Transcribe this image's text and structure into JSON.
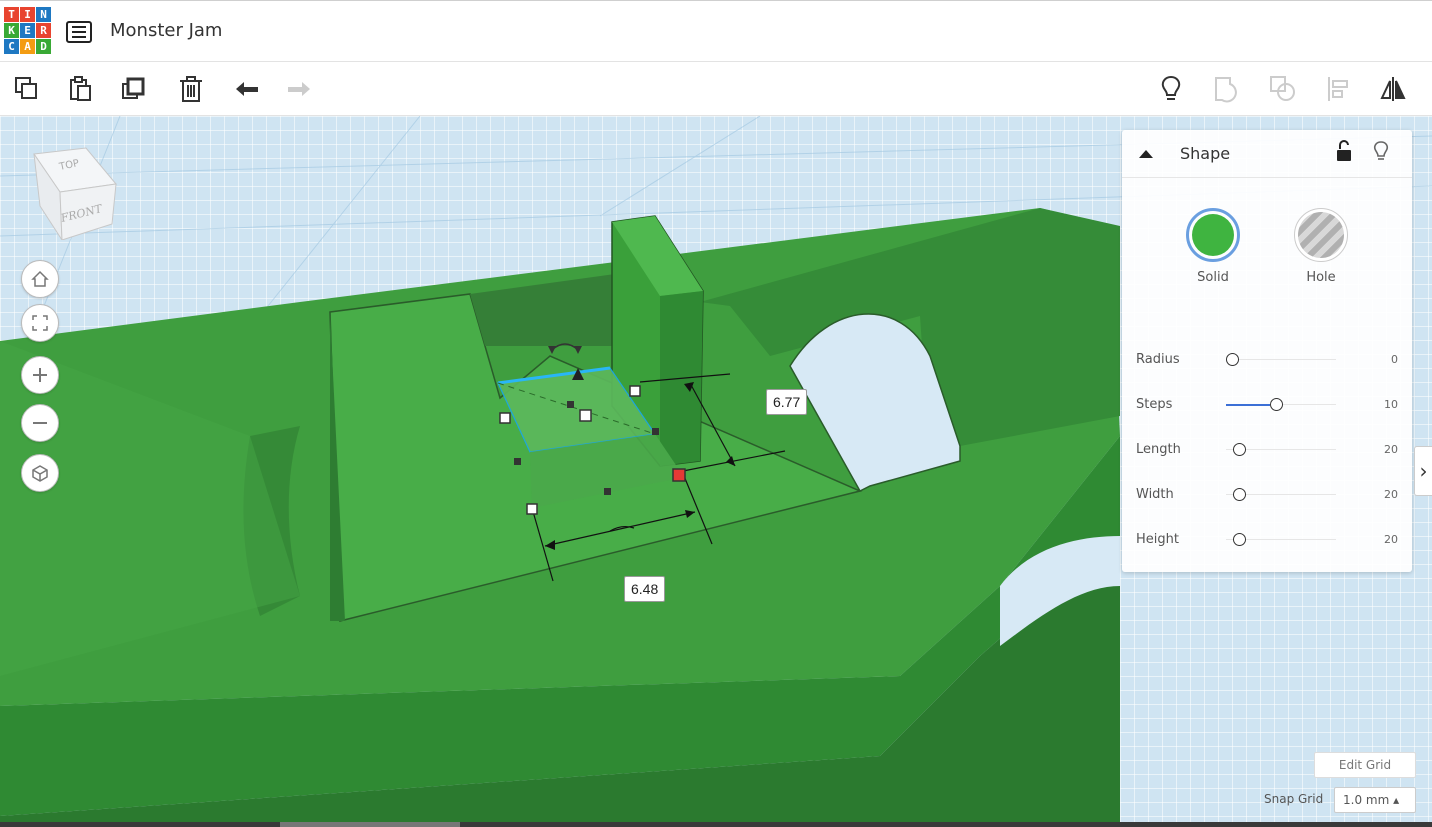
{
  "app": {
    "logo_letters": [
      "T",
      "I",
      "N",
      "K",
      "E",
      "R",
      "C",
      "A",
      "D"
    ],
    "logo_colors": [
      "#e8442f",
      "#e8442f",
      "#1e78c2",
      "#39a935",
      "#1e78c2",
      "#e8442f",
      "#1e78c2",
      "#f39c12",
      "#39a935"
    ],
    "project_title": "Monster Jam"
  },
  "toolbar": {
    "left_tools": [
      {
        "icon": "copy-icon"
      },
      {
        "icon": "paste-icon"
      },
      {
        "icon": "duplicate-icon"
      },
      {
        "icon": "delete-icon"
      },
      {
        "icon": "undo-icon"
      },
      {
        "icon": "redo-icon"
      }
    ],
    "right_tools": [
      {
        "icon": "lightbulb-icon"
      },
      {
        "icon": "group-icon"
      },
      {
        "icon": "ungroup-icon"
      },
      {
        "icon": "align-icon"
      },
      {
        "icon": "mirror-icon"
      }
    ]
  },
  "viewcube": {
    "top_label": "TOP",
    "front_label": "FRONT"
  },
  "dimensions": {
    "depth_value": "6.77",
    "width_value": "6.48"
  },
  "shape_panel": {
    "title": "Shape",
    "solid_label": "Solid",
    "hole_label": "Hole",
    "solid_color": "#3fb440",
    "properties": [
      {
        "label": "Radius",
        "value": "0",
        "fraction": 0.0
      },
      {
        "label": "Steps",
        "value": "10",
        "fraction": 0.4
      },
      {
        "label": "Length",
        "value": "20",
        "fraction": 0.06
      },
      {
        "label": "Width",
        "value": "20",
        "fraction": 0.06
      },
      {
        "label": "Height",
        "value": "20",
        "fraction": 0.06
      }
    ]
  },
  "grid": {
    "edit_grid_label": "Edit Grid",
    "snap_grid_label": "Snap Grid",
    "snap_grid_value": "1.0 mm ▴"
  },
  "colors": {
    "model_green": "#3f9e3f",
    "model_green_dark": "#2e7d32",
    "workplane": "#cfe4f2",
    "accent_blue": "#1aa7ec"
  }
}
